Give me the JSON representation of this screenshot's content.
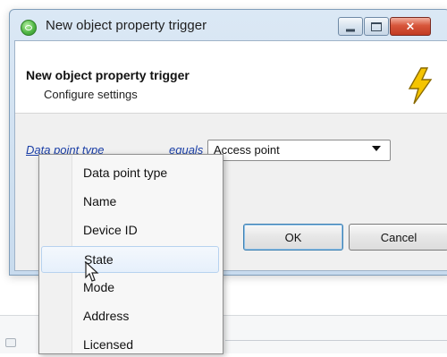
{
  "window": {
    "title": "New object property trigger",
    "buttons": {
      "minimize": "minimize",
      "maximize": "maximize",
      "close": "×"
    }
  },
  "header": {
    "title": "New object property trigger",
    "subtitle": "Configure settings",
    "icon": "lightning-bolt-icon"
  },
  "condition": {
    "field_link": "Data point type",
    "operator_link": "equals",
    "selected_value": "Access point"
  },
  "buttons": {
    "ok": "OK",
    "cancel": "Cancel"
  },
  "dropdown": {
    "items": [
      {
        "label": "Data point type"
      },
      {
        "label": "Name"
      },
      {
        "label": "Device ID"
      },
      {
        "label": "State",
        "hovered": true
      },
      {
        "label": "Mode"
      },
      {
        "label": "Address"
      },
      {
        "label": "Licensed"
      }
    ]
  },
  "colors": {
    "link": "#1a3ea6",
    "title_bar": "#dbe8f5",
    "close_button": "#c23b22",
    "bolt": "#f5c400"
  }
}
